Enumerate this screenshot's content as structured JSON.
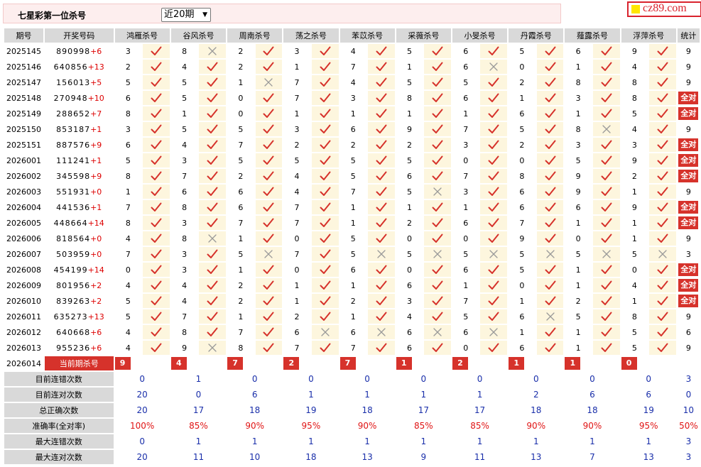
{
  "header": {
    "title": "七星彩第一位杀号",
    "period_select": "近20期",
    "logo": "cz89.com"
  },
  "columns": [
    "期号",
    "开奖号码",
    "鸿雁杀号",
    "谷风杀号",
    "周南杀号",
    "荡之杀号",
    "苯苡杀号",
    "采薇杀号",
    "小旻杀号",
    "丹霞杀号",
    "薤露杀号",
    "浮萍杀号",
    "统计"
  ],
  "rows": [
    {
      "period": "2025145",
      "draw": "890998",
      "sum": "+6",
      "kills": [
        "3",
        "8",
        "2",
        "3",
        "4",
        "5",
        "6",
        "5",
        "6",
        "9"
      ],
      "ok": [
        1,
        0,
        1,
        1,
        1,
        1,
        1,
        1,
        1,
        1
      ],
      "count": "9"
    },
    {
      "period": "2025146",
      "draw": "640856",
      "sum": "+13",
      "kills": [
        "2",
        "4",
        "2",
        "1",
        "7",
        "1",
        "6",
        "0",
        "1",
        "4"
      ],
      "ok": [
        1,
        1,
        1,
        1,
        1,
        1,
        0,
        1,
        1,
        1
      ],
      "count": "9"
    },
    {
      "period": "2025147",
      "draw": "156013",
      "sum": "+5",
      "kills": [
        "5",
        "5",
        "1",
        "7",
        "4",
        "5",
        "5",
        "2",
        "8",
        "8"
      ],
      "ok": [
        1,
        1,
        0,
        1,
        1,
        1,
        1,
        1,
        1,
        1
      ],
      "count": "9"
    },
    {
      "period": "2025148",
      "draw": "270948",
      "sum": "+10",
      "kills": [
        "6",
        "5",
        "0",
        "7",
        "3",
        "8",
        "6",
        "1",
        "3",
        "8"
      ],
      "ok": [
        1,
        1,
        1,
        1,
        1,
        1,
        1,
        1,
        1,
        1
      ],
      "count": "全对"
    },
    {
      "period": "2025149",
      "draw": "288652",
      "sum": "+7",
      "kills": [
        "8",
        "1",
        "0",
        "1",
        "1",
        "1",
        "1",
        "6",
        "1",
        "5"
      ],
      "ok": [
        1,
        1,
        1,
        1,
        1,
        1,
        1,
        1,
        1,
        1
      ],
      "count": "全对"
    },
    {
      "period": "2025150",
      "draw": "853187",
      "sum": "+1",
      "kills": [
        "3",
        "5",
        "5",
        "3",
        "6",
        "9",
        "7",
        "5",
        "8",
        "4"
      ],
      "ok": [
        1,
        1,
        1,
        1,
        1,
        1,
        1,
        1,
        0,
        1
      ],
      "count": "9"
    },
    {
      "period": "2025151",
      "draw": "887576",
      "sum": "+9",
      "kills": [
        "6",
        "4",
        "7",
        "2",
        "2",
        "2",
        "3",
        "2",
        "3",
        "3"
      ],
      "ok": [
        1,
        1,
        1,
        1,
        1,
        1,
        1,
        1,
        1,
        1
      ],
      "count": "全对"
    },
    {
      "period": "2026001",
      "draw": "111241",
      "sum": "+1",
      "kills": [
        "5",
        "3",
        "5",
        "5",
        "5",
        "5",
        "0",
        "0",
        "5",
        "9"
      ],
      "ok": [
        1,
        1,
        1,
        1,
        1,
        1,
        1,
        1,
        1,
        1
      ],
      "count": "全对"
    },
    {
      "period": "2026002",
      "draw": "345598",
      "sum": "+9",
      "kills": [
        "8",
        "7",
        "2",
        "4",
        "5",
        "6",
        "7",
        "8",
        "9",
        "2"
      ],
      "ok": [
        1,
        1,
        1,
        1,
        1,
        1,
        1,
        1,
        1,
        1
      ],
      "count": "全对"
    },
    {
      "period": "2026003",
      "draw": "551931",
      "sum": "+0",
      "kills": [
        "1",
        "6",
        "6",
        "4",
        "7",
        "5",
        "3",
        "6",
        "9",
        "1"
      ],
      "ok": [
        1,
        1,
        1,
        1,
        1,
        0,
        1,
        1,
        1,
        1
      ],
      "count": "9"
    },
    {
      "period": "2026004",
      "draw": "441536",
      "sum": "+1",
      "kills": [
        "7",
        "8",
        "6",
        "7",
        "1",
        "1",
        "1",
        "6",
        "6",
        "9"
      ],
      "ok": [
        1,
        1,
        1,
        1,
        1,
        1,
        1,
        1,
        1,
        1
      ],
      "count": "全对"
    },
    {
      "period": "2026005",
      "draw": "448664",
      "sum": "+14",
      "kills": [
        "8",
        "3",
        "7",
        "7",
        "1",
        "2",
        "6",
        "7",
        "1",
        "1"
      ],
      "ok": [
        1,
        1,
        1,
        1,
        1,
        1,
        1,
        1,
        1,
        1
      ],
      "count": "全对"
    },
    {
      "period": "2026006",
      "draw": "818564",
      "sum": "+0",
      "kills": [
        "4",
        "8",
        "1",
        "0",
        "5",
        "0",
        "0",
        "9",
        "0",
        "1"
      ],
      "ok": [
        1,
        0,
        1,
        1,
        1,
        1,
        1,
        1,
        1,
        1
      ],
      "count": "9"
    },
    {
      "period": "2026007",
      "draw": "503959",
      "sum": "+0",
      "kills": [
        "7",
        "3",
        "5",
        "7",
        "5",
        "5",
        "5",
        "5",
        "5",
        "5"
      ],
      "ok": [
        1,
        1,
        0,
        1,
        0,
        0,
        0,
        0,
        0,
        0
      ],
      "count": "3"
    },
    {
      "period": "2026008",
      "draw": "454199",
      "sum": "+14",
      "kills": [
        "0",
        "3",
        "1",
        "0",
        "6",
        "0",
        "6",
        "5",
        "1",
        "0"
      ],
      "ok": [
        1,
        1,
        1,
        1,
        1,
        1,
        1,
        1,
        1,
        1
      ],
      "count": "全对"
    },
    {
      "period": "2026009",
      "draw": "801956",
      "sum": "+2",
      "kills": [
        "4",
        "4",
        "2",
        "1",
        "1",
        "6",
        "1",
        "0",
        "1",
        "4"
      ],
      "ok": [
        1,
        1,
        1,
        1,
        1,
        1,
        1,
        1,
        1,
        1
      ],
      "count": "全对"
    },
    {
      "period": "2026010",
      "draw": "839263",
      "sum": "+2",
      "kills": [
        "5",
        "4",
        "2",
        "1",
        "2",
        "3",
        "7",
        "1",
        "2",
        "1"
      ],
      "ok": [
        1,
        1,
        1,
        1,
        1,
        1,
        1,
        1,
        1,
        1
      ],
      "count": "全对"
    },
    {
      "period": "2026011",
      "draw": "635273",
      "sum": "+13",
      "kills": [
        "5",
        "7",
        "1",
        "2",
        "1",
        "4",
        "5",
        "6",
        "5",
        "8"
      ],
      "ok": [
        1,
        1,
        1,
        1,
        1,
        1,
        1,
        0,
        1,
        1
      ],
      "count": "9"
    },
    {
      "period": "2026012",
      "draw": "640668",
      "sum": "+6",
      "kills": [
        "4",
        "8",
        "7",
        "6",
        "6",
        "6",
        "6",
        "1",
        "1",
        "5"
      ],
      "ok": [
        1,
        1,
        1,
        0,
        0,
        0,
        0,
        1,
        1,
        1
      ],
      "count": "6"
    },
    {
      "period": "2026013",
      "draw": "955236",
      "sum": "+6",
      "kills": [
        "4",
        "9",
        "8",
        "7",
        "7",
        "6",
        "0",
        "6",
        "1",
        "5"
      ],
      "ok": [
        1,
        0,
        1,
        1,
        1,
        1,
        1,
        1,
        1,
        1
      ],
      "count": "9"
    }
  ],
  "current": {
    "period": "2026014",
    "label": "当前期杀号",
    "kills": [
      "9",
      "4",
      "7",
      "2",
      "7",
      "1",
      "2",
      "1",
      "1",
      "0"
    ]
  },
  "stats": [
    {
      "label": "目前连错次数",
      "values": [
        "0",
        "1",
        "0",
        "0",
        "0",
        "0",
        "0",
        "0",
        "0",
        "0",
        "3"
      ],
      "red": false
    },
    {
      "label": "目前连对次数",
      "values": [
        "20",
        "0",
        "6",
        "1",
        "1",
        "1",
        "1",
        "2",
        "6",
        "6",
        "0"
      ],
      "red": false
    },
    {
      "label": "总正确次数",
      "values": [
        "20",
        "17",
        "18",
        "19",
        "18",
        "17",
        "17",
        "18",
        "18",
        "19",
        "10"
      ],
      "red": false
    },
    {
      "label": "准确率(全对率)",
      "values": [
        "100%",
        "85%",
        "90%",
        "95%",
        "90%",
        "85%",
        "85%",
        "90%",
        "90%",
        "95%",
        "50%"
      ],
      "red": true
    },
    {
      "label": "最大连错次数",
      "values": [
        "0",
        "1",
        "1",
        "1",
        "1",
        "1",
        "1",
        "1",
        "1",
        "1",
        "3"
      ],
      "red": false
    },
    {
      "label": "最大连对次数",
      "values": [
        "20",
        "11",
        "10",
        "18",
        "13",
        "9",
        "11",
        "13",
        "7",
        "13",
        "3"
      ],
      "red": false
    }
  ],
  "colors": {
    "check": "#d6322b",
    "cross": "#9a9a9a",
    "badge": "#d6322b",
    "stat_blue": "#1a2faa",
    "stat_red": "#e01414"
  },
  "icons": {
    "ok": "check-icon",
    "miss": "cross-icon"
  }
}
